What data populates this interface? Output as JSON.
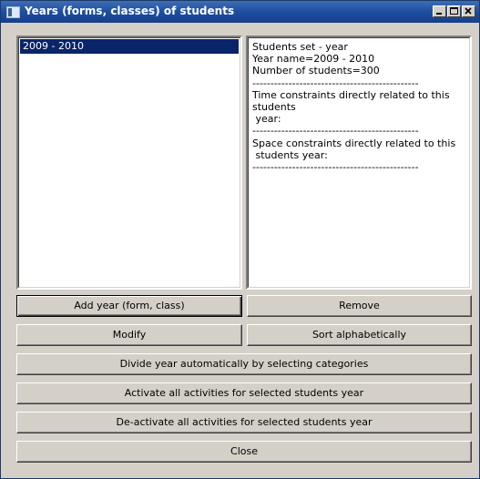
{
  "window": {
    "title": "Years (forms, classes) of students",
    "icon": "app-icon",
    "controls": {
      "minimize": "minimize-icon",
      "maximize": "maximize-icon",
      "close": "close-icon"
    }
  },
  "years_list": {
    "items": [
      "2009 - 2010"
    ],
    "selected_index": 0
  },
  "details": {
    "text": "Students set - year\nYear name=2009 - 2010\nNumber of students=300\n----------------------------------------------\nTime constraints directly related to this students\n year:\n----------------------------------------------\nSpace constraints directly related to this\n students year:\n----------------------------------------------"
  },
  "buttons": {
    "add": "Add year (form, class)",
    "remove": "Remove",
    "modify": "Modify",
    "sort": "Sort alphabetically",
    "divide": "Divide year automatically by selecting categories",
    "activate": "Activate all activities for selected students year",
    "deactivate": "De-activate all activities for selected students year",
    "close": "Close"
  },
  "colors": {
    "titlebar": "#1e4ea0",
    "selection": "#0a246a",
    "face": "#d4d0c8"
  }
}
